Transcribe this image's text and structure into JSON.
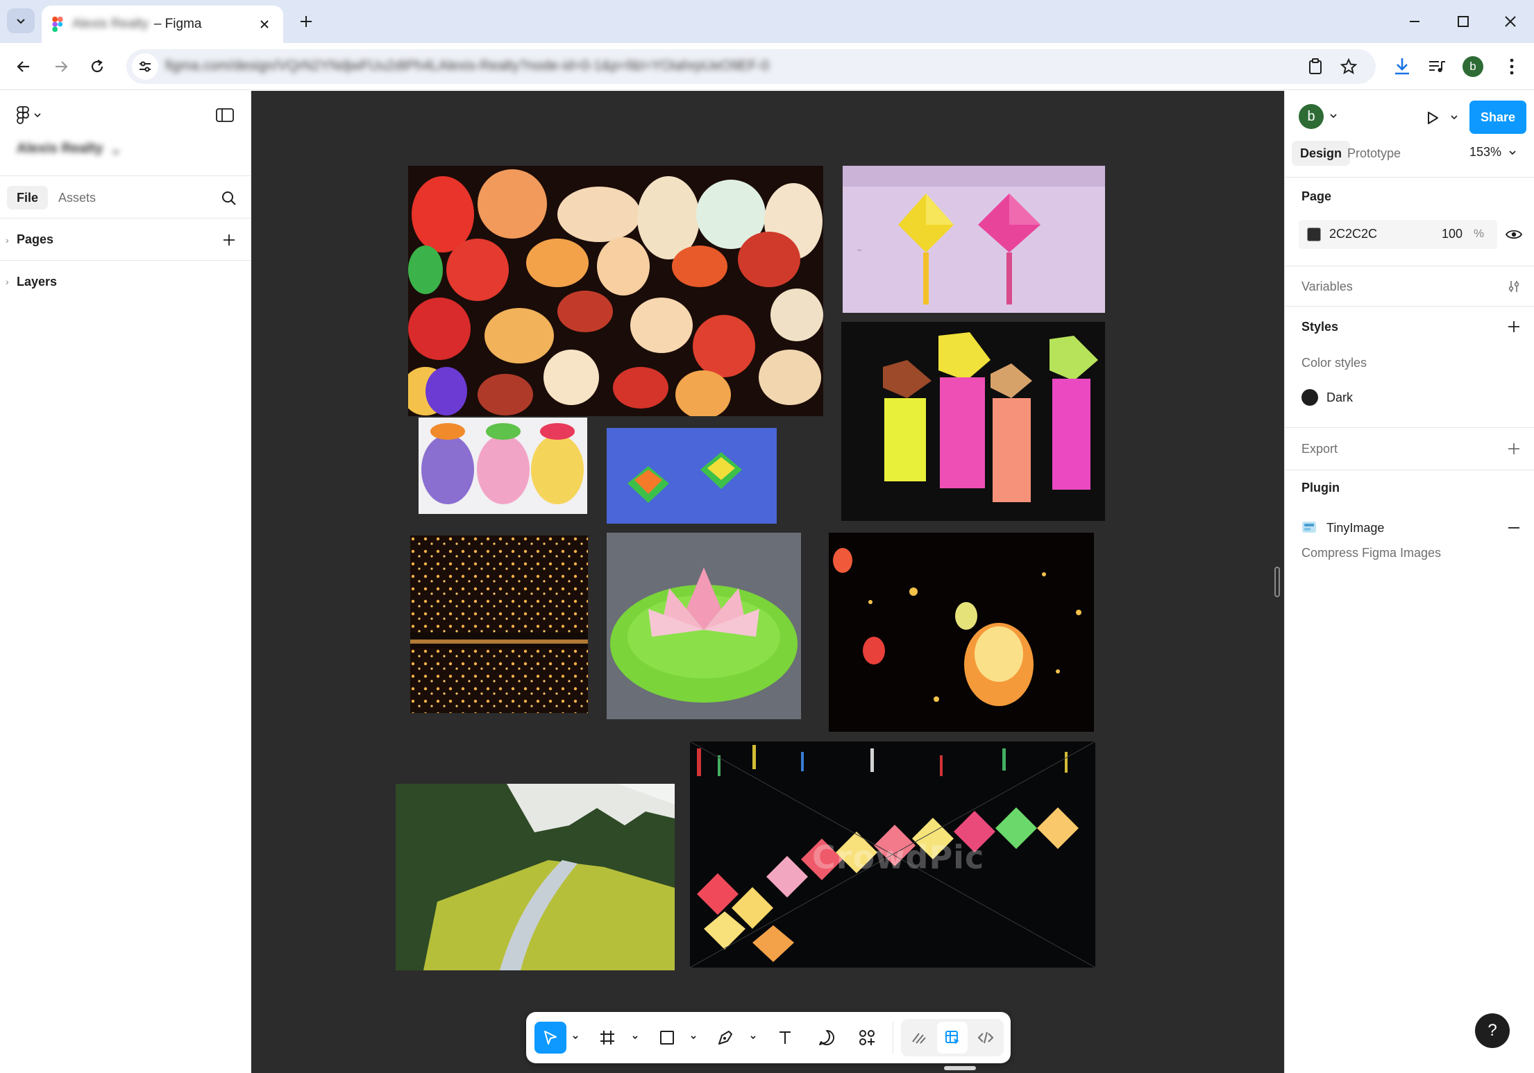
{
  "browser": {
    "tab_title_blurred": "Alexis Realty",
    "tab_title_suffix": "– Figma",
    "url_blurred": "figma.com/design/VQrN2YNdjwFUu2dtPh4LAlexis-Realty?node-id=0-1&p=f&t=YOiahrpUeO9EF-0"
  },
  "figma": {
    "file_name_blurred": "Alexis Realty",
    "left_panel": {
      "tabs": [
        "File",
        "Assets"
      ],
      "sections": [
        "Pages",
        "Layers"
      ]
    },
    "canvas": {
      "background": "#2c2c2c",
      "watermark": "CrowdPic"
    },
    "right_panel": {
      "avatar_letter": "b",
      "share_label": "Share",
      "tabs": [
        "Design",
        "Prototype"
      ],
      "zoom": "153%",
      "page_heading": "Page",
      "page_color_hex": "2C2C2C",
      "page_opacity": "100",
      "page_opacity_unit": "%",
      "variables_label": "Variables",
      "styles_heading": "Styles",
      "color_styles_label": "Color styles",
      "color_style_name": "Dark",
      "export_label": "Export",
      "plugin_heading": "Plugin",
      "plugin_name": "TinyImage",
      "plugin_desc": "Compress Figma Images",
      "help_label": "?"
    }
  },
  "profile": {
    "avatar_letter": "b"
  },
  "colors": {
    "accent": "#0d99ff",
    "avatar": "#2e6b35",
    "canvas": "#2c2c2c"
  }
}
